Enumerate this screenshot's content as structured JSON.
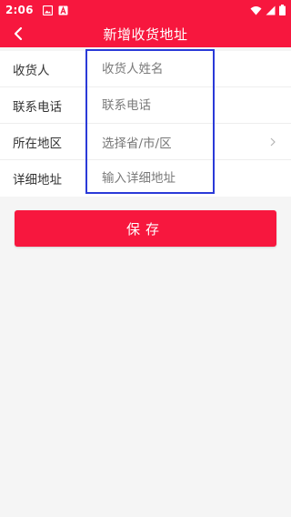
{
  "status_bar": {
    "time": "2:06"
  },
  "header": {
    "title": "新增收货地址"
  },
  "form": {
    "rows": [
      {
        "label": "收货人",
        "placeholder": "收货人姓名"
      },
      {
        "label": "联系电话",
        "placeholder": "联系电话"
      },
      {
        "label": "所在地区",
        "placeholder": "选择省/市/区"
      },
      {
        "label": "详细地址",
        "placeholder": "输入详细地址"
      }
    ]
  },
  "save_button": {
    "label": "保存"
  },
  "colors": {
    "accent": "#f7173e",
    "highlight": "#2a3ad8",
    "background": "#f5f5f5"
  },
  "icons": [
    "image-icon",
    "a-icon",
    "wifi-icon",
    "signal-icon",
    "battery-icon",
    "back-arrow-icon",
    "chevron-right-icon"
  ]
}
